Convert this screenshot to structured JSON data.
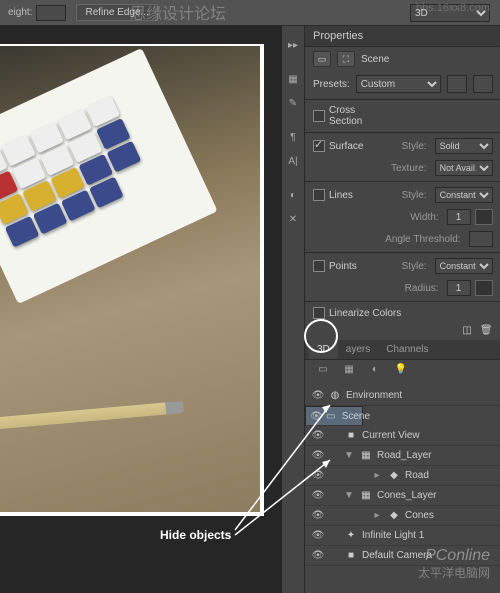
{
  "topbar": {
    "eight_label": "eight:",
    "refine": "Refine Edge...",
    "mode": "3D"
  },
  "watermarks": {
    "top": "思缘设计论坛",
    "top2": "bbs.16xx8.com",
    "pc": "PConline",
    "cn": "太平洋电脑网"
  },
  "properties": {
    "title": "Properties",
    "scene": "Scene",
    "presets_label": "Presets:",
    "preset": "Custom",
    "cross_section": {
      "label": "Cross Section",
      "checked": false
    },
    "surface": {
      "label": "Surface",
      "checked": true,
      "style_label": "Style:",
      "style": "Solid",
      "texture_label": "Texture:",
      "texture": "Not Avail..."
    },
    "lines": {
      "label": "Lines",
      "checked": false,
      "style_label": "Style:",
      "style": "Constant",
      "width_label": "Width:",
      "width": "1",
      "angle_label": "Angle Threshold:",
      "angle": ""
    },
    "points": {
      "label": "Points",
      "checked": false,
      "style_label": "Style:",
      "style": "Constant",
      "radius_label": "Radius:",
      "radius": "1"
    },
    "linearize": {
      "label": "Linearize Colors",
      "checked": false
    }
  },
  "tabs": {
    "t1": "3D",
    "t2": "ayers",
    "t3": "Channels"
  },
  "tree": [
    {
      "name": "Environment",
      "icon": "◍",
      "eye": true
    },
    {
      "name": "Scene",
      "icon": "▭",
      "eye": true,
      "sel": true
    },
    {
      "name": "Current View",
      "icon": "■",
      "eye": true,
      "indent": 1
    },
    {
      "name": "Road_Layer",
      "icon": "▦",
      "eye": true,
      "indent": 1,
      "tw": "▼"
    },
    {
      "name": "Road",
      "icon": "◆",
      "eye": true,
      "indent": 3,
      "tw": "▸"
    },
    {
      "name": "Cones_Layer",
      "icon": "▦",
      "eye": true,
      "indent": 1,
      "tw": "▼"
    },
    {
      "name": "Cones",
      "icon": "◆",
      "eye": true,
      "indent": 3,
      "tw": "▸"
    },
    {
      "name": "Infinite Light 1",
      "icon": "✦",
      "eye": true,
      "indent": 1
    },
    {
      "name": "Default Camera",
      "icon": "■",
      "eye": true,
      "indent": 1
    }
  ],
  "annotation": {
    "hide": "Hide objects"
  }
}
